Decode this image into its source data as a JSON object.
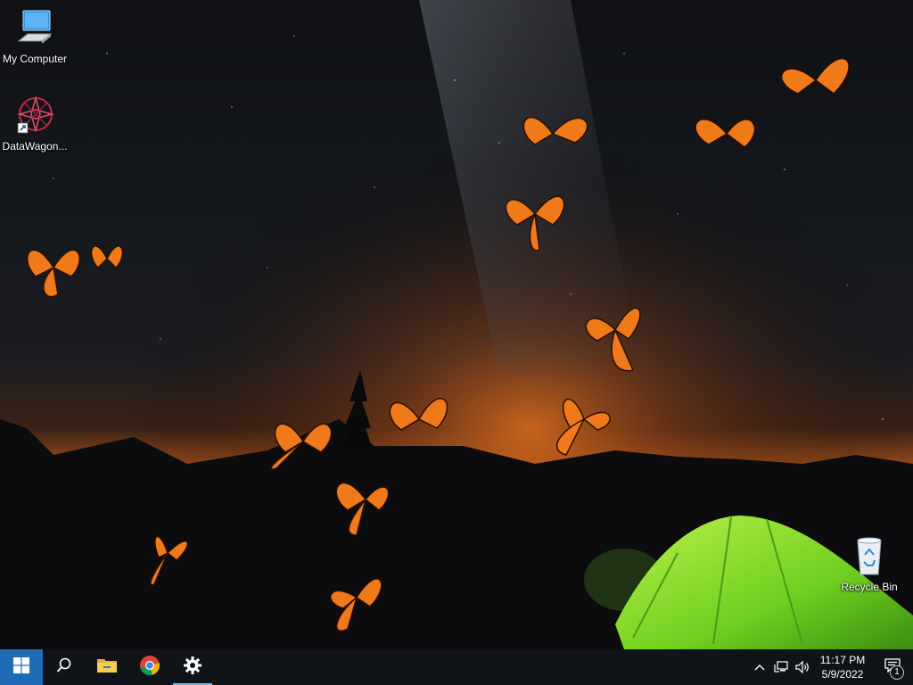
{
  "desktop": {
    "icons": [
      {
        "label": "My Computer",
        "icon": "computer-icon"
      },
      {
        "label": "DataWagon...",
        "icon": "datawagon-shortcut-icon"
      },
      {
        "label": "Recycle Bin",
        "icon": "recycle-bin-icon"
      }
    ],
    "wallpaper": "night sky with milky way, mountains, green tent and monarch butterflies"
  },
  "taskbar": {
    "start": {
      "icon": "windows-logo-icon"
    },
    "search": {
      "icon": "search-icon"
    },
    "pinned": [
      {
        "name": "File Explorer",
        "icon": "folder-icon"
      },
      {
        "name": "Google Chrome",
        "icon": "chrome-icon"
      },
      {
        "name": "Settings",
        "icon": "gear-icon",
        "active": true
      }
    ],
    "tray": {
      "icons": [
        "chevron-up-icon",
        "network-icon",
        "volume-icon"
      ],
      "time": "11:17 PM",
      "date": "5/9/2022",
      "notification_count": "1"
    }
  },
  "colors": {
    "taskbar_bg": "#101317",
    "accent": "#76b9ed",
    "tent_green": "#7fd32a",
    "butterfly_orange": "#f07a1a"
  }
}
